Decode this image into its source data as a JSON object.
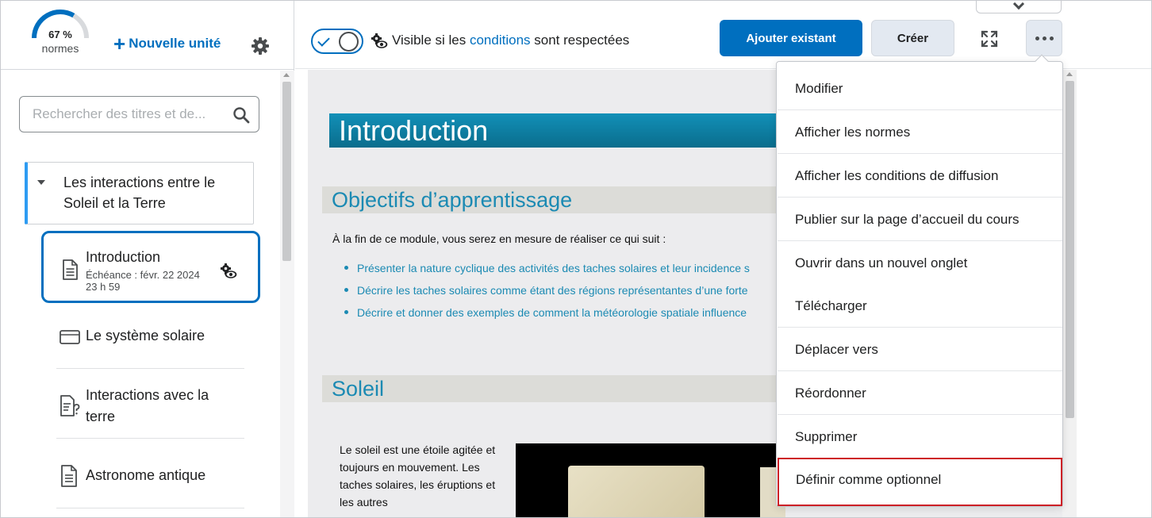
{
  "sidebar": {
    "progress": {
      "percent_label": "67 %",
      "label": "normes",
      "fraction": 0.67
    },
    "new_unit_label": "Nouvelle unité",
    "search_placeholder": "Rechercher des titres et de...",
    "unit": {
      "title": "Les interactions entre le Soleil et la Terre"
    },
    "selected_topic": {
      "title": "Introduction",
      "due": "Échéance : févr. 22 2024 23 h 59"
    },
    "items": [
      {
        "label": "Le système solaire",
        "icon": "card-icon"
      },
      {
        "label": "Interactions avec la terre",
        "icon": "quiz-icon"
      },
      {
        "label": "Astronome antique",
        "icon": "document-icon"
      }
    ]
  },
  "toolbar": {
    "visibility_prefix": "Visible si les",
    "visibility_link": "conditions",
    "visibility_suffix": "sont respectées",
    "add_existing_label": "Ajouter existant",
    "create_label": "Créer"
  },
  "document": {
    "heading_intro": "Introduction",
    "heading_objectives": "Objectifs  d’apprentissage",
    "intro_sentence": "À la fin de ce module, vous serez en mesure de réaliser ce qui suit :",
    "objectives": [
      "Présenter la nature cyclique des activités des taches solaires et leur incidence s",
      "Décrire les taches solaires comme étant des régions représentantes d’une forte",
      "Décrire et donner des exemples de comment la météorologie spatiale influence"
    ],
    "heading_sun": "Soleil",
    "sun_paragraph": "Le soleil est une étoile agitée et toujours en mouvement. Les taches solaires, les éruptions et les autres"
  },
  "menu": {
    "items": [
      "Modifier",
      "Afficher les normes",
      "Afficher les conditions de diffusion",
      "Publier sur la page d’accueil du cours",
      "Ouvrir dans un nouvel onglet",
      "Télécharger",
      "Déplacer vers",
      "Réordonner",
      "Supprimer",
      "Définir comme optionnel"
    ],
    "highlighted_index": 9
  },
  "colors": {
    "accent": "#006fbf",
    "unit_bar": "#2e9cf2",
    "heading_teal": "#1b8ab3",
    "highlight_border": "#cd2026"
  }
}
